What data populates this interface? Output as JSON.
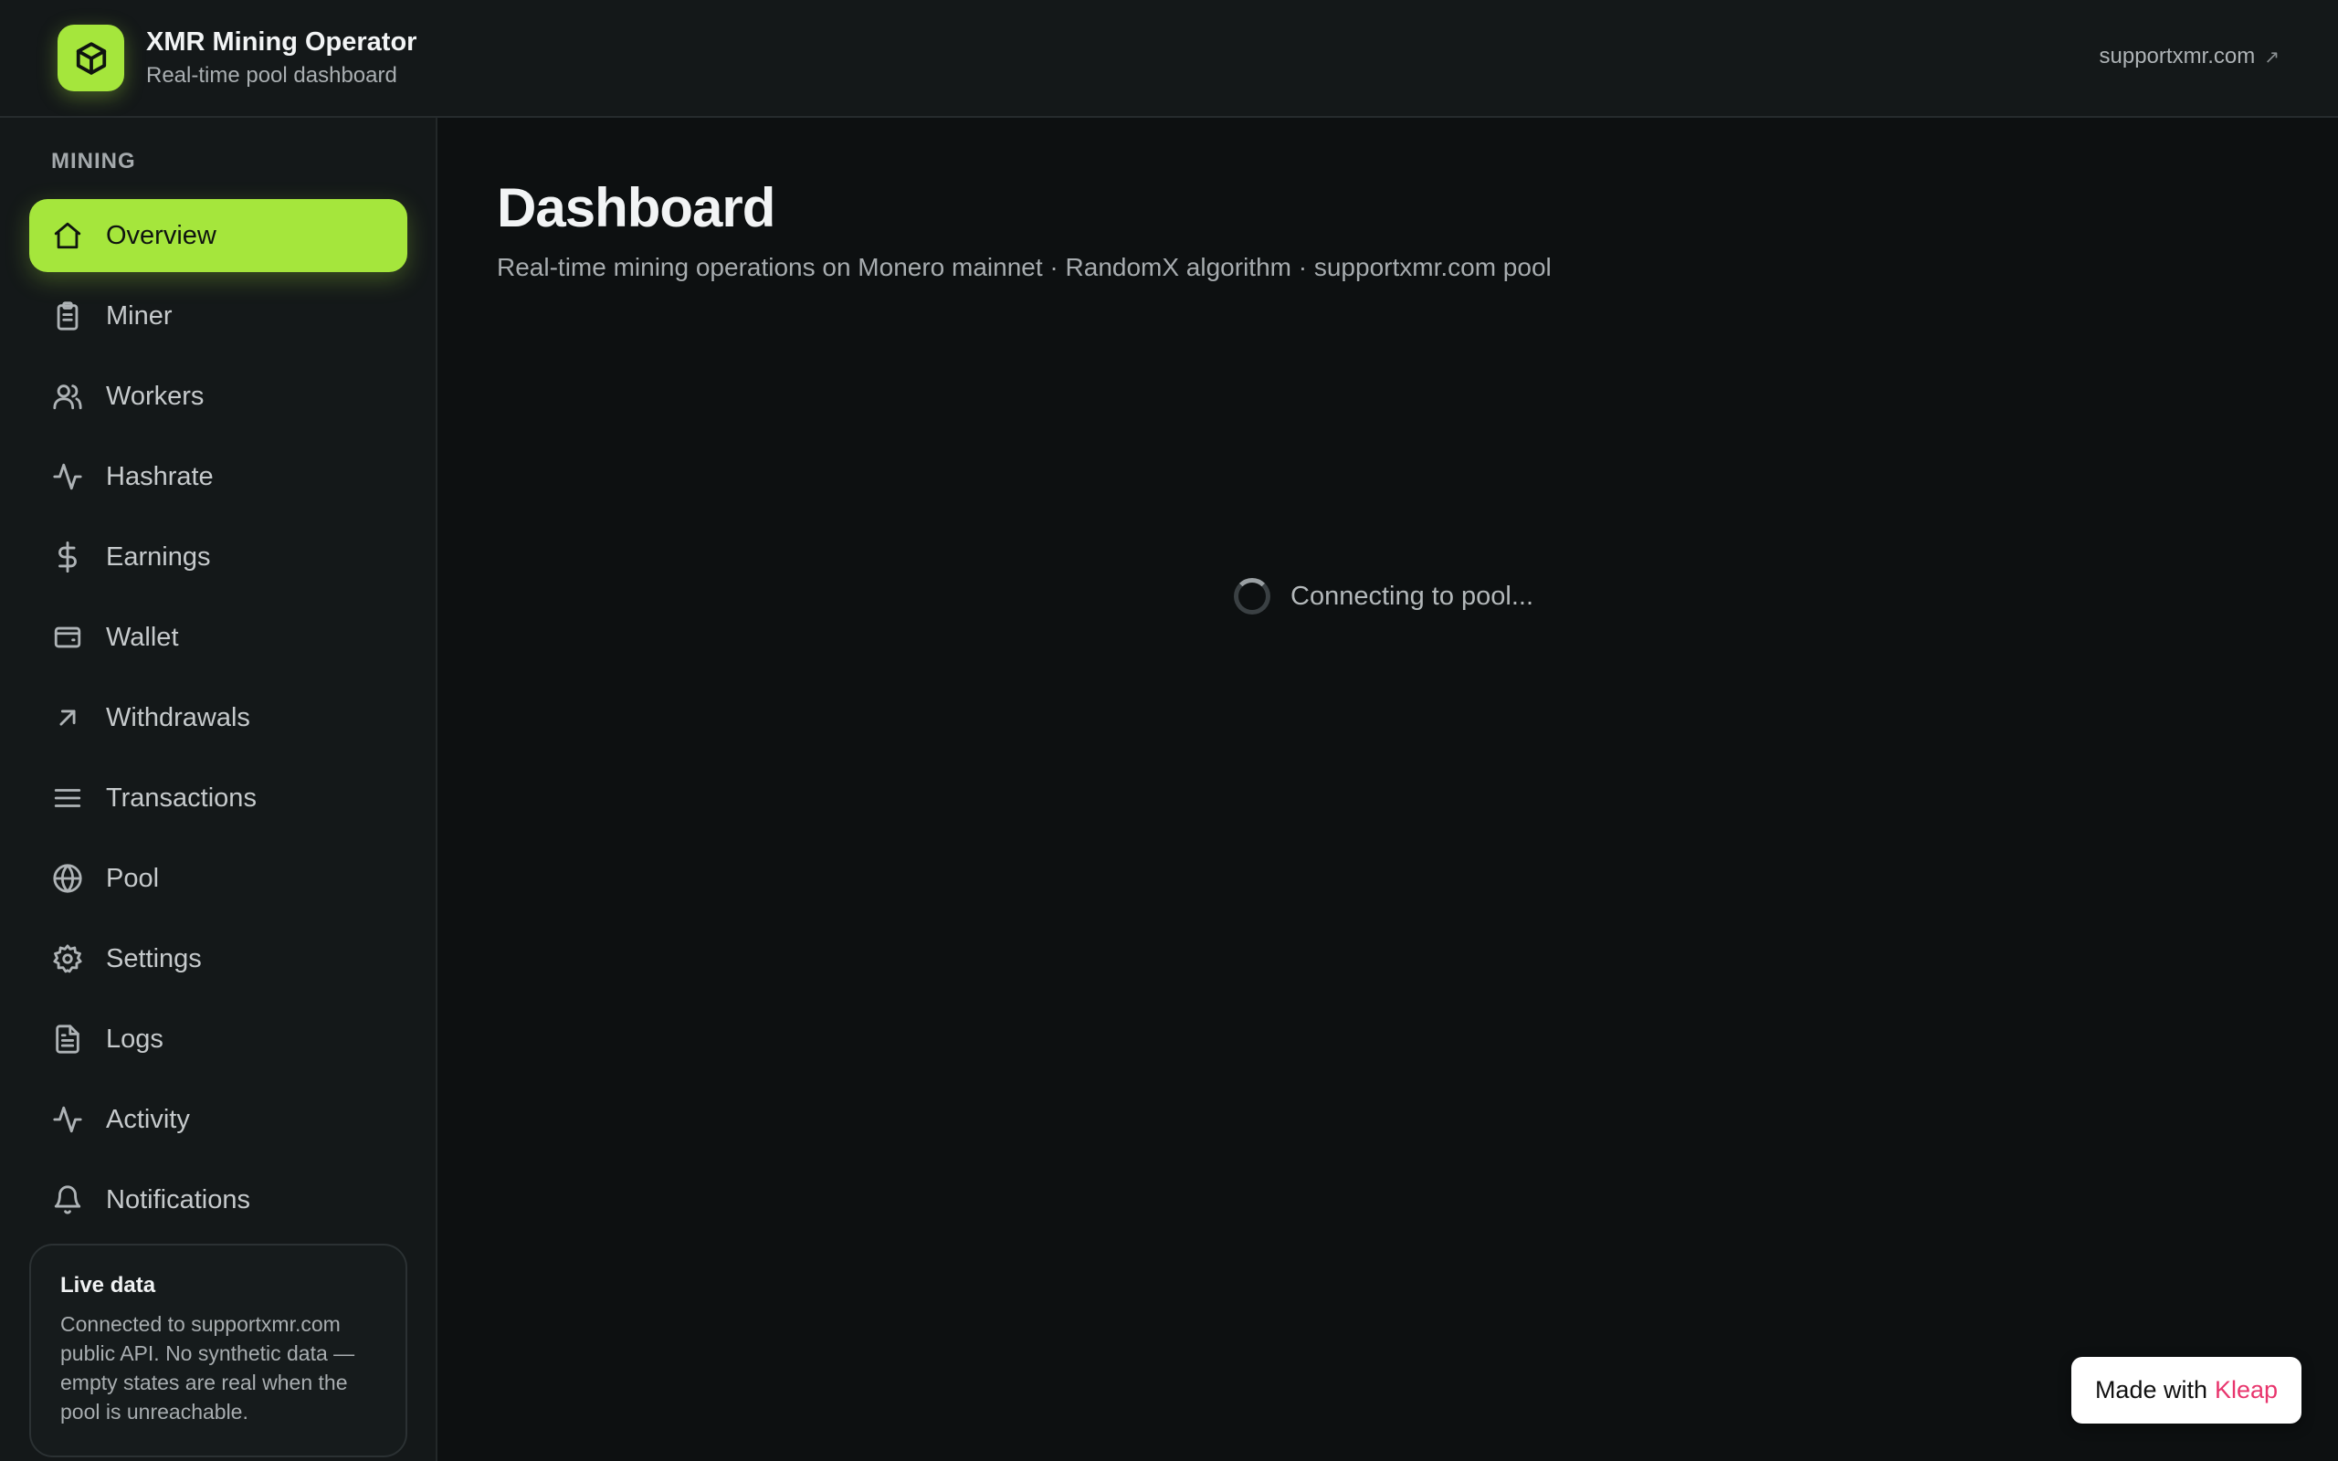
{
  "header": {
    "app_title": "XMR Mining Operator",
    "app_subtitle": "Real-time pool dashboard",
    "external_link": "supportxmr.com",
    "external_icon": "↗"
  },
  "sidebar": {
    "section_label": "MINING",
    "items": [
      {
        "label": "Overview",
        "icon": "home-icon",
        "active": true
      },
      {
        "label": "Miner",
        "icon": "clipboard-icon"
      },
      {
        "label": "Workers",
        "icon": "users-icon"
      },
      {
        "label": "Hashrate",
        "icon": "activity-icon"
      },
      {
        "label": "Earnings",
        "icon": "dollar-icon"
      },
      {
        "label": "Wallet",
        "icon": "wallet-icon"
      },
      {
        "label": "Withdrawals",
        "icon": "arrow-up-right-icon"
      },
      {
        "label": "Transactions",
        "icon": "list-icon"
      },
      {
        "label": "Pool",
        "icon": "globe-icon"
      },
      {
        "label": "Settings",
        "icon": "gear-icon"
      },
      {
        "label": "Logs",
        "icon": "file-text-icon"
      },
      {
        "label": "Activity",
        "icon": "activity-icon"
      },
      {
        "label": "Notifications",
        "icon": "bell-icon"
      }
    ],
    "live_card": {
      "title": "Live data",
      "text": "Connected to supportxmr.com public API. No synthetic data — empty states are real when the pool is unreachable."
    }
  },
  "main": {
    "title": "Dashboard",
    "subtitle": "Real-time mining operations on Monero mainnet · RandomX algorithm · supportxmr.com pool",
    "loading_text": "Connecting to pool..."
  },
  "badge": {
    "prefix": "Made with",
    "brand": "Kleap"
  },
  "colors": {
    "accent": "#a5e63c",
    "background": "#0d1011",
    "panel": "#141819",
    "brand_pink": "#e8356d"
  }
}
